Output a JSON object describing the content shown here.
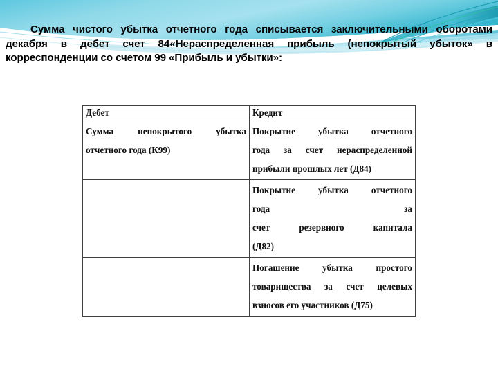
{
  "slide": {
    "background_color": "#ffffff",
    "decoration": {
      "name": "teal-swoosh-banner",
      "colors": {
        "band_light": "#a9e0ee",
        "band_mid": "#67cfe2",
        "band_deep": "#2fb5cd",
        "line_teal": "#1f9fae",
        "line_green": "#39b58a",
        "white": "#ffffff"
      }
    },
    "intro_paragraph": "Сумма чистого убытка отчетного года списывается заключительными оборотами декабря в дебет счет 84«Нераспределенная прибыль (непокрытый убыток» в корреспонденции со счетом 99 «Прибыль и убытки»:"
  },
  "table": {
    "headers": {
      "debit": "Дебет",
      "credit": "Кредит"
    },
    "rows": [
      {
        "debit": "Сумма непокрытого убытка отчетного года (К99)",
        "debit_lines": [
          "Сумма непокрытого убытка",
          "отчетного года (К99)"
        ],
        "credit": "Покрытие убытка отчетного года за счет нераспределенной прибыли прошлых лет (Д84)",
        "credit_lines": [
          "Покрытие убытка отчетного",
          "года за счет нераспределенной",
          "прибыли прошлых лет  (Д84)"
        ]
      },
      {
        "debit": "",
        "debit_lines": [],
        "credit": "Покрытие убытка отчетного года за счет резервного капитала (Д82)",
        "credit_lines": [
          "Покрытие убытка отчетного",
          "года за",
          "счет резервного капитала",
          "(Д82)"
        ]
      },
      {
        "debit": "",
        "debit_lines": [],
        "credit": "Погашение убытка простого товарищества за счет целевых взносов его участников (Д75)",
        "credit_lines": [
          "Погашение убытка простого",
          "товарищества за счет целевых",
          "взносов его участников (Д75)"
        ]
      }
    ]
  }
}
